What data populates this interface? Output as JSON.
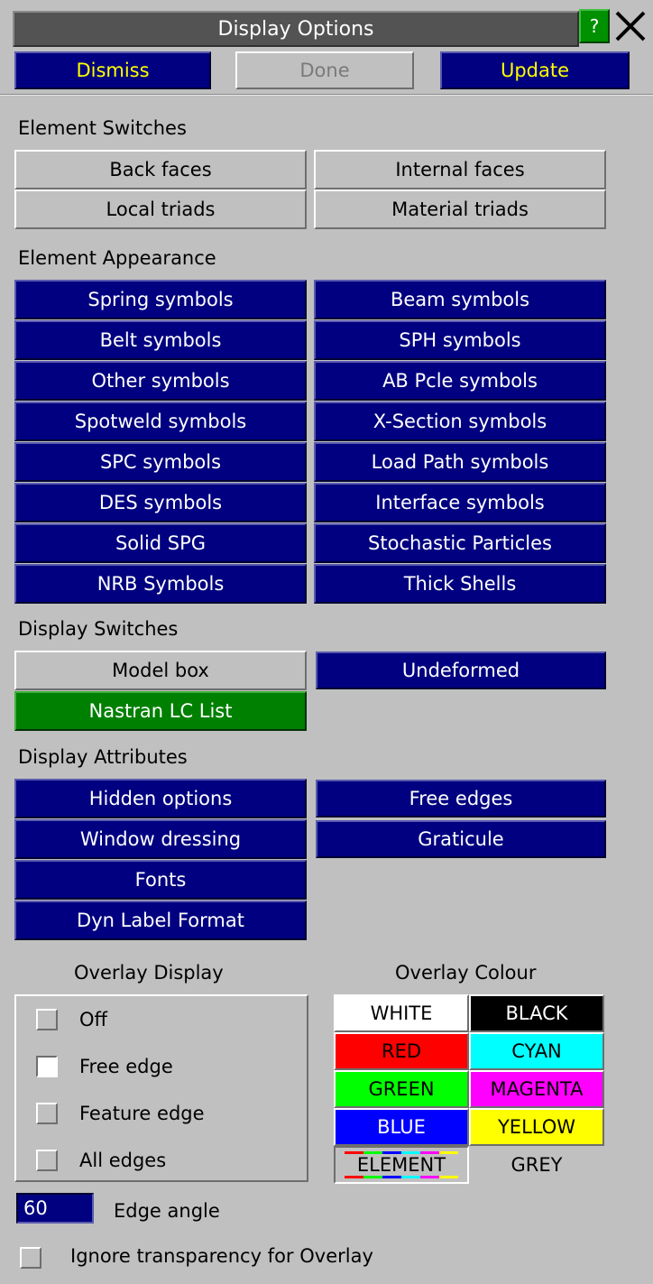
{
  "window": {
    "title": "Display Options",
    "help_label": "?",
    "close_label": "✕"
  },
  "top_buttons": {
    "dismiss": "Dismiss",
    "done": "Done",
    "update": "Update"
  },
  "element_switches": {
    "heading": "Element Switches",
    "buttons": [
      "Back faces",
      "Internal faces",
      "Local triads",
      "Material triads"
    ]
  },
  "element_appearance": {
    "heading": "Element Appearance",
    "buttons": [
      "Spring symbols",
      "Beam symbols",
      "Belt symbols",
      "SPH symbols",
      "Other symbols",
      "AB Pcle symbols",
      "Spotweld symbols",
      "X-Section symbols",
      "SPC symbols",
      "Load Path symbols",
      "DES symbols",
      "Interface symbols",
      "Solid SPG",
      "Stochastic Particles",
      "NRB Symbols",
      "Thick Shells"
    ]
  },
  "display_switches": {
    "heading": "Display Switches",
    "model_box": "Model box",
    "undeformed": "Undeformed",
    "nastran": "Nastran LC List"
  },
  "display_attributes": {
    "heading": "Display Attributes",
    "hidden_options": "Hidden options",
    "free_edges": "Free edges",
    "window_dressing": "Window dressing",
    "graticule": "Graticule",
    "fonts": "Fonts",
    "dyn_label_format": "Dyn Label Format"
  },
  "overlay_display": {
    "heading": "Overlay Display",
    "options": [
      "Off",
      "Free edge",
      "Feature edge",
      "All edges"
    ],
    "selected": "Free edge"
  },
  "overlay_colour": {
    "heading": "Overlay Colour",
    "swatches": [
      {
        "label": "WHITE",
        "bg": "#ffffff",
        "fg": "#000000"
      },
      {
        "label": "BLACK",
        "bg": "#000000",
        "fg": "#ffffff"
      },
      {
        "label": "RED",
        "bg": "#ff0000",
        "fg": "#000000"
      },
      {
        "label": "CYAN",
        "bg": "#00ffff",
        "fg": "#000000"
      },
      {
        "label": "GREEN",
        "bg": "#00ff00",
        "fg": "#000000"
      },
      {
        "label": "MAGENTA",
        "bg": "#ff00ff",
        "fg": "#000000"
      },
      {
        "label": "BLUE",
        "bg": "#0000ff",
        "fg": "#ffffff"
      },
      {
        "label": "YELLOW",
        "bg": "#ffff00",
        "fg": "#000000"
      },
      {
        "label": "ELEMENT",
        "bg": "#c0c0c0",
        "fg": "#000000"
      },
      {
        "label": "GREY",
        "bg": "#c0c0c0",
        "fg": "#000000"
      }
    ]
  },
  "edge_angle": {
    "value": "60",
    "label": "Edge angle"
  },
  "ignore_transparency": {
    "label": "Ignore transparency for Overlay",
    "checked": false
  }
}
